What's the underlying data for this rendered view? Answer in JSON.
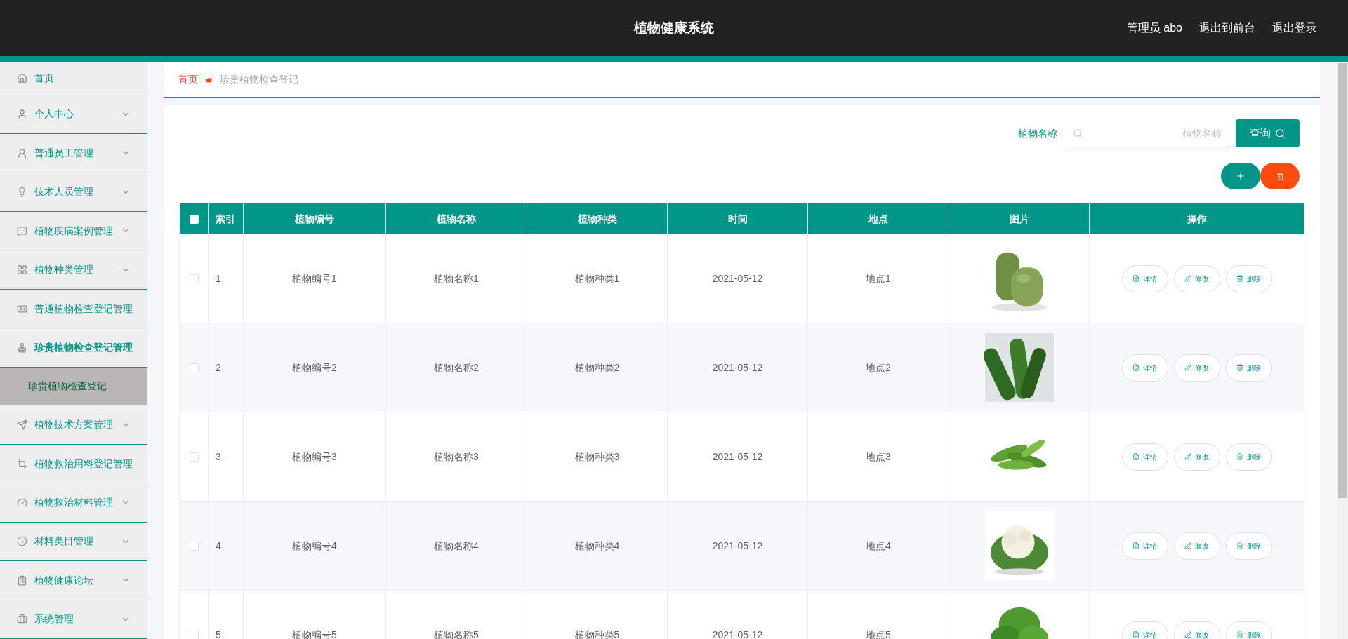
{
  "header": {
    "title": "植物健康系统",
    "links": [
      "管理员 abo",
      "退出到前台",
      "退出登录"
    ]
  },
  "sidebar": {
    "items": [
      {
        "label": "首页",
        "kind": "link",
        "expanded": false
      },
      {
        "label": "个人中心",
        "kind": "group",
        "expanded": false
      },
      {
        "label": "普通员工管理",
        "kind": "group",
        "expanded": false
      },
      {
        "label": "技术人员管理",
        "kind": "group",
        "expanded": false
      },
      {
        "label": "植物疾病案例管理",
        "kind": "group",
        "expanded": false
      },
      {
        "label": "植物种类管理",
        "kind": "group",
        "expanded": false
      },
      {
        "label": "普通植物检查登记管理",
        "kind": "link",
        "expanded": false
      },
      {
        "label": "珍贵植物检查登记管理",
        "kind": "link",
        "expanded": true,
        "children": [
          {
            "label": "珍贵植物检查登记",
            "selected": true
          }
        ]
      },
      {
        "label": "植物技术方案管理",
        "kind": "group",
        "expanded": false
      },
      {
        "label": "植物救治用料登记管理",
        "kind": "link",
        "expanded": false
      },
      {
        "label": "植物救治材料管理",
        "kind": "group",
        "expanded": false
      },
      {
        "label": "材料类目管理",
        "kind": "group",
        "expanded": false
      },
      {
        "label": "植物健康论坛",
        "kind": "group",
        "expanded": false
      },
      {
        "label": "系统管理",
        "kind": "group",
        "expanded": false
      }
    ]
  },
  "breadcrumb": [
    "首页",
    "珍贵植物检查登记"
  ],
  "search": {
    "label": "植物名称",
    "placeholder": "植物名称",
    "button": "查询"
  },
  "table": {
    "header_checked": false,
    "columns": [
      "索引",
      "植物编号",
      "植物名称",
      "植物种类",
      "时间",
      "地点",
      "图片",
      "操作"
    ],
    "rows": [
      {
        "checked": false,
        "cells": [
          "1",
          "植物编号1",
          "植物名称1",
          "植物种类1",
          "2021-05-12",
          "地点1"
        ],
        "actions": [
          "详情",
          "修改",
          "删除"
        ]
      },
      {
        "checked": false,
        "cells": [
          "2",
          "植物编号2",
          "植物名称2",
          "植物种类2",
          "2021-05-12",
          "地点2"
        ],
        "actions": [
          "详情",
          "修改",
          "删除"
        ]
      },
      {
        "checked": false,
        "cells": [
          "3",
          "植物编号3",
          "植物名称3",
          "植物种类3",
          "2021-05-12",
          "地点3"
        ],
        "actions": [
          "详情",
          "修改",
          "删除"
        ]
      },
      {
        "checked": false,
        "cells": [
          "4",
          "植物编号4",
          "植物名称4",
          "植物种类4",
          "2021-05-12",
          "地点4"
        ],
        "actions": [
          "详情",
          "修改",
          "删除"
        ]
      },
      {
        "checked": false,
        "cells": [
          "5",
          "植物编号5",
          "植物名称5",
          "植物种类5",
          "2021-05-12",
          "地点5"
        ],
        "actions": [
          "详情",
          "修改",
          "删除"
        ]
      }
    ]
  }
}
